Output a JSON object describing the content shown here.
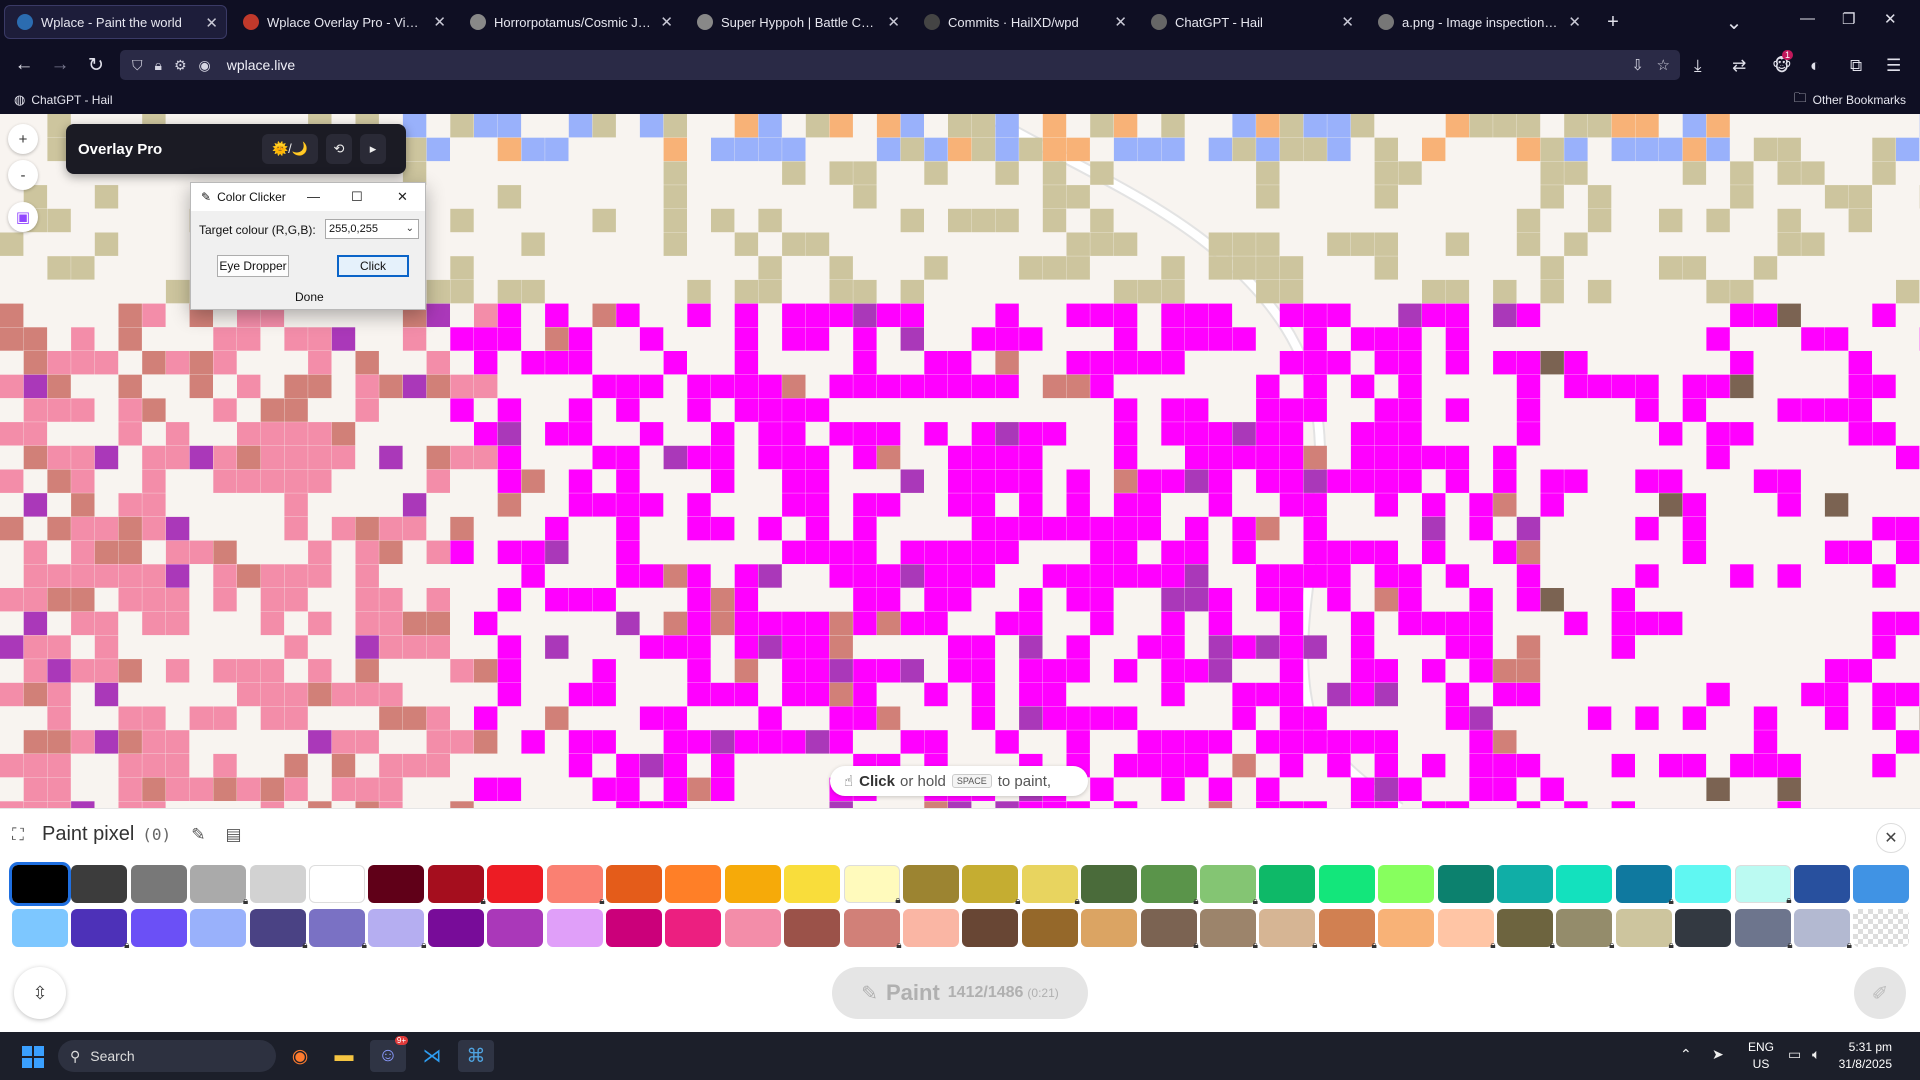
{
  "browser": {
    "tabs": [
      {
        "label": "Wplace - Paint the world",
        "active": true,
        "icon": "wplace-favicon",
        "color": "#2b6cb0"
      },
      {
        "label": "Wplace Overlay Pro - Violentmonkey",
        "active": false,
        "icon": "violentmonkey-favicon",
        "color": "#c0392b"
      },
      {
        "label": "Horrorpotamus/Cosmic Juggernaut",
        "active": false,
        "icon": "page-favicon",
        "color": "#888888"
      },
      {
        "label": "Super Hyppoh | Battle Cats Wiki",
        "active": false,
        "icon": "page-favicon",
        "color": "#888888"
      },
      {
        "label": "Commits · HailXD/wpd",
        "active": false,
        "icon": "github-favicon",
        "color": "#444444"
      },
      {
        "label": "ChatGPT - Hail",
        "active": false,
        "icon": "chatgpt-favicon",
        "color": "#666666"
      },
      {
        "label": "a.png - Image inspection multi",
        "active": false,
        "icon": "image-favicon",
        "color": "#777777"
      }
    ],
    "url": "wplace.live",
    "bookmarks": [
      {
        "label": "ChatGPT - Hail"
      }
    ],
    "other_bookmarks": "Other Bookmarks",
    "extension_badge": "1"
  },
  "overlay_pro": {
    "title": "Overlay Pro",
    "theme_toggle": "🌞/🌙",
    "refresh": "⟲",
    "collapse": "▸"
  },
  "color_clicker": {
    "title": "Color Clicker",
    "target_label": "Target colour (R,G,B):",
    "target_value": "255,0,255",
    "eye_dropper": "Eye Dropper",
    "click": "Click",
    "done": "Done"
  },
  "map_controls": {
    "zoom_in": "+",
    "zoom_out": "-"
  },
  "paint_hint": {
    "prefix": "Click",
    "middle": "or hold",
    "key": "SPACE",
    "suffix": "to paint,"
  },
  "paint_panel": {
    "title": "Paint pixel",
    "count": "(0)",
    "paint_label": "Paint",
    "charges": "1412/1486",
    "timer": "(0:21)"
  },
  "palette": {
    "row1": [
      {
        "color": "#000000",
        "locked": false,
        "selected": true
      },
      {
        "color": "#3c3c3c",
        "locked": false
      },
      {
        "color": "#787878",
        "locked": false
      },
      {
        "color": "#aaaaaa",
        "locked": true
      },
      {
        "color": "#d2d2d2",
        "locked": false
      },
      {
        "color": "#ffffff",
        "locked": false
      },
      {
        "color": "#600018",
        "locked": false
      },
      {
        "color": "#a50e1e",
        "locked": true
      },
      {
        "color": "#ed1c24",
        "locked": false
      },
      {
        "color": "#fa8072",
        "locked": true
      },
      {
        "color": "#e45c1a",
        "locked": false
      },
      {
        "color": "#ff7f27",
        "locked": false
      },
      {
        "color": "#f6aa09",
        "locked": false
      },
      {
        "color": "#f9dd3b",
        "locked": false
      },
      {
        "color": "#fffabc",
        "locked": true
      },
      {
        "color": "#9c8431",
        "locked": false
      },
      {
        "color": "#c5ad31",
        "locked": true
      },
      {
        "color": "#e8d45f",
        "locked": true
      },
      {
        "color": "#4a6b3a",
        "locked": false
      },
      {
        "color": "#5a944a",
        "locked": true
      },
      {
        "color": "#84c573",
        "locked": true
      },
      {
        "color": "#0eb968",
        "locked": false
      },
      {
        "color": "#13e67b",
        "locked": false
      },
      {
        "color": "#87ff5e",
        "locked": false
      },
      {
        "color": "#0c816e",
        "locked": false
      },
      {
        "color": "#10aea6",
        "locked": false
      },
      {
        "color": "#13e1be",
        "locked": false
      },
      {
        "color": "#0f799f",
        "locked": true
      },
      {
        "color": "#60f7f2",
        "locked": false
      },
      {
        "color": "#bbfaf2",
        "locked": true
      },
      {
        "color": "#28509e",
        "locked": false
      },
      {
        "color": "#4093e4",
        "locked": false
      }
    ],
    "row2": [
      {
        "color": "#7dc7ff",
        "locked": false
      },
      {
        "color": "#4d31b8",
        "locked": true
      },
      {
        "color": "#6b50f6",
        "locked": false
      },
      {
        "color": "#99b1fb",
        "locked": false
      },
      {
        "color": "#4a4284",
        "locked": true
      },
      {
        "color": "#7a71c4",
        "locked": true
      },
      {
        "color": "#b5aef1",
        "locked": true
      },
      {
        "color": "#780c99",
        "locked": false
      },
      {
        "color": "#aa38b9",
        "locked": false
      },
      {
        "color": "#e09ff9",
        "locked": false
      },
      {
        "color": "#cb007a",
        "locked": false
      },
      {
        "color": "#ec1f80",
        "locked": false
      },
      {
        "color": "#f38da9",
        "locked": false
      },
      {
        "color": "#9b5249",
        "locked": false
      },
      {
        "color": "#d18078",
        "locked": true
      },
      {
        "color": "#fab6a4",
        "locked": false
      },
      {
        "color": "#684634",
        "locked": false
      },
      {
        "color": "#95682a",
        "locked": false
      },
      {
        "color": "#dba463",
        "locked": false
      },
      {
        "color": "#7b6352",
        "locked": true
      },
      {
        "color": "#9c846b",
        "locked": true
      },
      {
        "color": "#d6b594",
        "locked": true
      },
      {
        "color": "#d18051",
        "locked": true
      },
      {
        "color": "#f8b277",
        "locked": false
      },
      {
        "color": "#ffc5a5",
        "locked": true
      },
      {
        "color": "#6d643f",
        "locked": true
      },
      {
        "color": "#948c6b",
        "locked": true
      },
      {
        "color": "#cdc59e",
        "locked": true
      },
      {
        "color": "#333941",
        "locked": false
      },
      {
        "color": "#6d758d",
        "locked": true
      },
      {
        "color": "#b3b9d1",
        "locked": true
      },
      {
        "color": "transparent",
        "locked": false
      }
    ]
  },
  "taskbar": {
    "search": "Search",
    "lang_top": "ENG",
    "lang_bottom": "US",
    "time": "5:31 pm",
    "date": "31/8/2025",
    "discord_badge": "9+"
  }
}
